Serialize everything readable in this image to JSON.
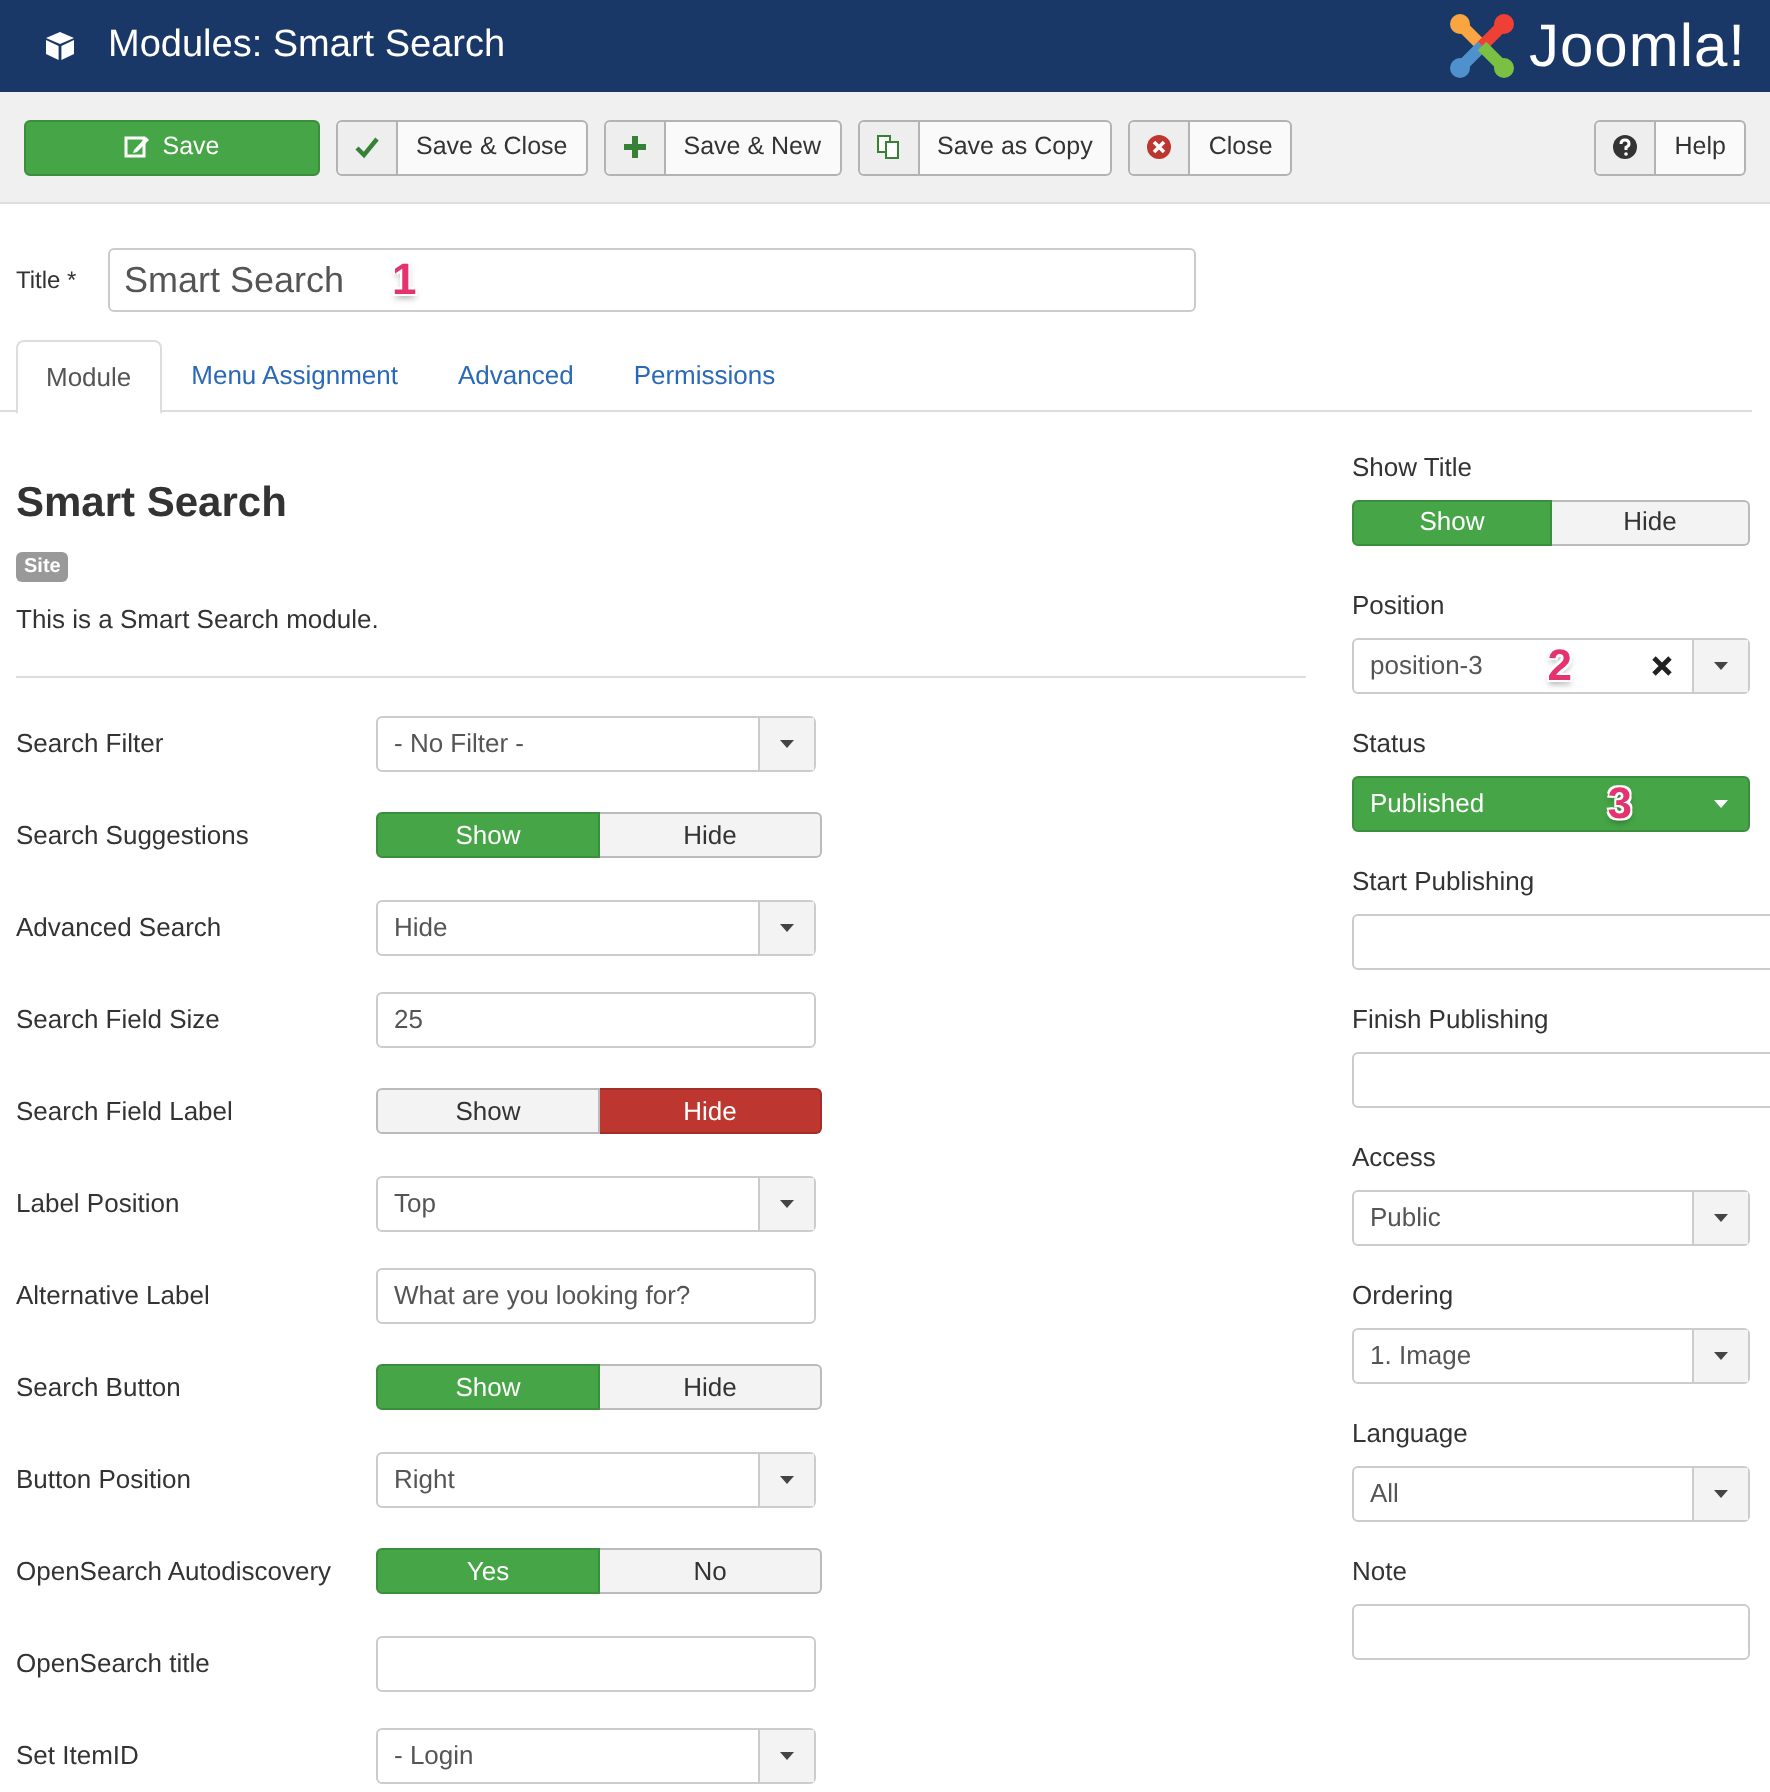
{
  "header": {
    "title": "Modules: Smart Search",
    "logo_text": "Joomla!"
  },
  "toolbar": [
    {
      "label": "Save",
      "kind": "edit",
      "primary": true
    },
    {
      "label": "Save & Close",
      "kind": "check",
      "primary": false
    },
    {
      "label": "Save & New",
      "kind": "plus",
      "primary": false
    },
    {
      "label": "Save as Copy",
      "kind": "copy",
      "primary": false
    },
    {
      "label": "Close",
      "kind": "cancel",
      "primary": false
    }
  ],
  "help_button": {
    "label": "Help"
  },
  "title_field": {
    "label": "Title *",
    "value": "Smart Search",
    "callout": "1"
  },
  "tabs": [
    {
      "label": "Module",
      "selected": true
    },
    {
      "label": "Menu Assignment",
      "selected": false
    },
    {
      "label": "Advanced",
      "selected": false
    },
    {
      "label": "Permissions",
      "selected": false
    }
  ],
  "module": {
    "heading": "Smart Search",
    "badge": "Site",
    "description": "This is a Smart Search module."
  },
  "fields": [
    {
      "label": "Search Filter",
      "kind": "select",
      "value": "- No Filter -"
    },
    {
      "label": "Search Suggestions",
      "kind": "toggle",
      "options": [
        {
          "label": "Show",
          "kind": "yes",
          "selected": true
        },
        {
          "label": "Hide",
          "kind": "no",
          "selected": false
        }
      ]
    },
    {
      "label": "Advanced Search",
      "kind": "select",
      "value": "Hide"
    },
    {
      "label": "Search Field Size",
      "kind": "text",
      "value": "25"
    },
    {
      "label": "Search Field Label",
      "kind": "toggle",
      "options": [
        {
          "label": "Show",
          "kind": "yes",
          "selected": false
        },
        {
          "label": "Hide",
          "kind": "no",
          "selected": true
        }
      ]
    },
    {
      "label": "Label Position",
      "kind": "select",
      "value": "Top"
    },
    {
      "label": "Alternative Label",
      "kind": "text",
      "value": "What are you looking for?"
    },
    {
      "label": "Search Button",
      "kind": "toggle",
      "options": [
        {
          "label": "Show",
          "kind": "yes",
          "selected": true
        },
        {
          "label": "Hide",
          "kind": "no",
          "selected": false
        }
      ]
    },
    {
      "label": "Button Position",
      "kind": "select",
      "value": "Right"
    },
    {
      "label": "OpenSearch Autodiscovery",
      "kind": "toggle",
      "options": [
        {
          "label": "Yes",
          "kind": "yes",
          "selected": true
        },
        {
          "label": "No",
          "kind": "no",
          "selected": false
        }
      ]
    },
    {
      "label": "OpenSearch title",
      "kind": "text"
    },
    {
      "label": "Set ItemID",
      "kind": "select",
      "value": "- Login"
    }
  ],
  "side_fields": [
    {
      "label": "Show Title",
      "kind": "toggle",
      "options": [
        {
          "label": "Show",
          "kind": "yes",
          "selected": true
        },
        {
          "label": "Hide",
          "kind": "no",
          "selected": false
        }
      ]
    },
    {
      "label": "Position",
      "kind": "clearable",
      "value": "position-3",
      "callout": "2"
    },
    {
      "label": "Status",
      "kind": "status",
      "value": "Published",
      "callout": "3"
    },
    {
      "label": "Start Publishing",
      "kind": "date"
    },
    {
      "label": "Finish Publishing",
      "kind": "date"
    },
    {
      "label": "Access",
      "kind": "select",
      "value": "Public"
    },
    {
      "label": "Ordering",
      "kind": "select",
      "value": "1. Image"
    },
    {
      "label": "Language",
      "kind": "select",
      "value": "All"
    },
    {
      "label": "Note",
      "kind": "text"
    }
  ]
}
